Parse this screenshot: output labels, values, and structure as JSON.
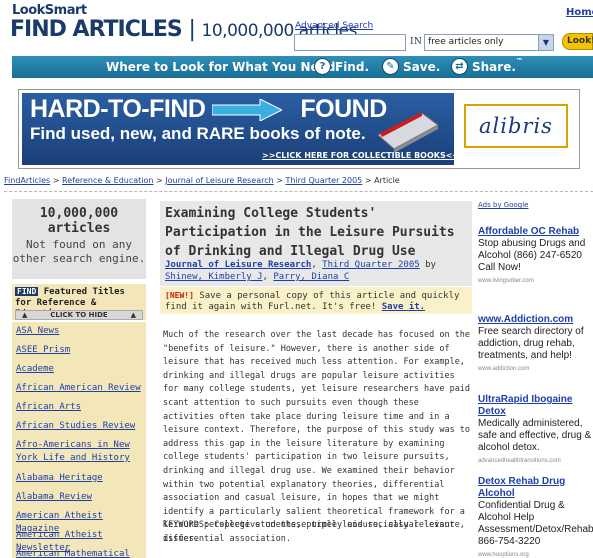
{
  "header": {
    "logo_small": "LookSmart",
    "logo_find": "FIND ARTICLES",
    "logo_sep": "|",
    "logo_count": "10,000,000 articles.",
    "advanced_search": "Advanced Search",
    "home_link": "Home",
    "search_value": "",
    "in_label": "IN",
    "scope_selected": "free articles only",
    "look_button": "Look!"
  },
  "where_bar": {
    "text": "Where to Look for What You Need.",
    "find_label": "Find.",
    "save_label": "Save.",
    "share_label": "Share.",
    "tm": "™"
  },
  "banner": {
    "headline_left": "HARD-TO-FIND",
    "headline_right": "FOUND",
    "subhead": "Find used, new, and RARE books of note.",
    "cta": ">>CLICK HERE FOR COLLECTIBLE BOOKS<<",
    "brand": "alibris"
  },
  "breadcrumb": {
    "items": [
      "FindArticles",
      "Reference & Education",
      "Journal of Leisure Research",
      "Third Quarter 2005"
    ],
    "sep": ">",
    "current": "Article"
  },
  "sidebar": {
    "promo_count": "10,000,000",
    "promo_unit": "articles",
    "promo_sub": "Not found on any other search engine.",
    "find_badge": "FIND",
    "featured_title": "Featured Titles for Reference & Education",
    "hide_label": "CLICK TO HIDE",
    "titles": [
      "ASA News",
      "ASEE Prism",
      "Academe",
      "African American Review",
      "African Arts",
      "African Studies Review",
      "Afro-Americans in New York Life and History",
      "Alabama Heritage",
      "Alabama Review",
      "American Atheist Magazine",
      "American Atheist Newsletter",
      "American Mathematical Monthly, The"
    ]
  },
  "article": {
    "title": "Examining College Students' Participation in the Leisure Pursuits of Drinking and Illegal Drug Use",
    "journal": "Journal of Leisure Research",
    "date": "Third Quarter 2005",
    "by": "by",
    "authors": [
      "Shinew, Kimberly J",
      "Parry, Diana C"
    ],
    "furl_new": "[NEW!]",
    "furl_text": "Save a personal copy of this article and quickly find it again with Furl.net. It's free!",
    "furl_link": "Save it.",
    "body": "Much of the research over the last decade has focused on the \"benefits of leisure.\" However, there is another side of leisure that has received much less attention. For example, drinking and illegal drugs are popular leisure activities for many college students, yet leisure researchers have paid scant attention to such pursuits even though these activities often take place during leisure time and in a leisure context. Therefore, the purpose of this study was to address this gap in the leisure literature by examining college students' participation in two leisure pursuits, drinking and illegal drug use. We examined their behavior within two potential explanatory theories, differential association and casual leisure, in hopes that we might identify a particularly salient theoretical framework for a leisure perspective on these timely and socially relevant issues.",
    "keywords": "KEYWORDS: College students, purple leisure, casual leisure, differential association."
  },
  "ads": {
    "label": "Ads by Google",
    "items": [
      {
        "title": "Affordable OC Rehab",
        "desc": "Stop abusing Drugs and Alcohol (866) 247-6520 Call Now!",
        "url": "www.livingsober.com"
      },
      {
        "title": "www.Addiction.com",
        "desc": "Free search directory of addiction, drug rehab, treatments, and help!",
        "url": "www.addiction.com"
      },
      {
        "title": "UltraRapid Ibogaine Detox",
        "desc": "Medically administered, safe and effective, drug & alcohol detox.",
        "url": "advancedhealthtransitions.com"
      },
      {
        "title": "Detox Rehab Drug Alcohol",
        "desc": "Confidential Drug & Alcohol Help Assessment/Detox/Rehab 866-754-3220",
        "url": "www.hooptions.org"
      }
    ]
  },
  "colors": {
    "brand_navy": "#1a3a6a",
    "where_bar": "#1a6e96",
    "link": "#1f3fa8",
    "sidebar_tan": "#f3e6b8",
    "look_button": "#f5c400"
  }
}
